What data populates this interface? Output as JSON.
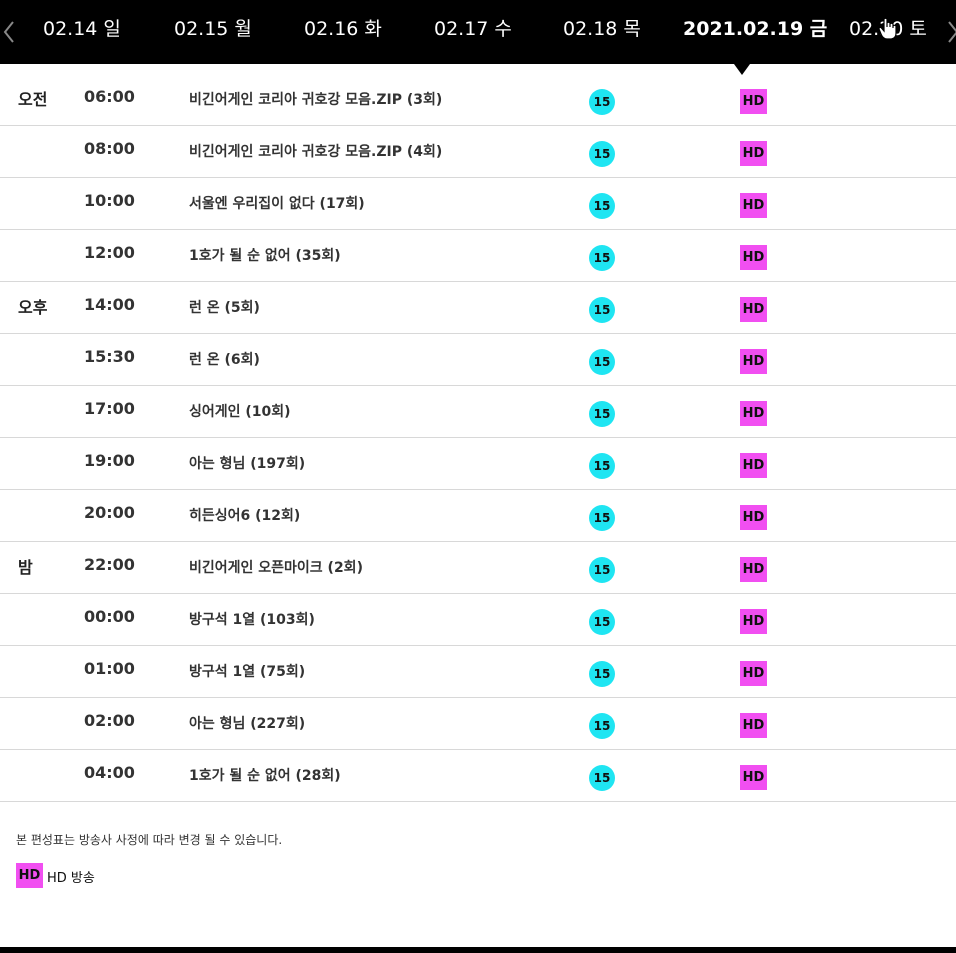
{
  "date_nav": {
    "tabs": [
      {
        "label": "02.14 일",
        "active": false
      },
      {
        "label": "02.15 월",
        "active": false
      },
      {
        "label": "02.16 화",
        "active": false
      },
      {
        "label": "02.17 수",
        "active": false
      },
      {
        "label": "02.18 목",
        "active": false
      },
      {
        "label": "2021.02.19 금",
        "active": true
      },
      {
        "label": "02.20 토",
        "active": false
      }
    ],
    "prev_icon": "chevron-left-icon",
    "next_icon": "chevron-right-icon"
  },
  "schedule": {
    "rows": [
      {
        "period": "오전",
        "time": "06:00",
        "title": "비긴어게인 코리아 귀호강 모음.ZIP (3회)",
        "rating": "15",
        "quality": "HD"
      },
      {
        "period": "",
        "time": "08:00",
        "title": "비긴어게인 코리아 귀호강 모음.ZIP (4회)",
        "rating": "15",
        "quality": "HD"
      },
      {
        "period": "",
        "time": "10:00",
        "title": "서울엔 우리집이 없다 (17회)",
        "rating": "15",
        "quality": "HD"
      },
      {
        "period": "",
        "time": "12:00",
        "title": "1호가 될 순 없어 (35회)",
        "rating": "15",
        "quality": "HD"
      },
      {
        "period": "오후",
        "time": "14:00",
        "title": "런 온 (5회)",
        "rating": "15",
        "quality": "HD"
      },
      {
        "period": "",
        "time": "15:30",
        "title": "런 온 (6회)",
        "rating": "15",
        "quality": "HD"
      },
      {
        "period": "",
        "time": "17:00",
        "title": "싱어게인 (10회)",
        "rating": "15",
        "quality": "HD"
      },
      {
        "period": "",
        "time": "19:00",
        "title": "아는 형님 (197회)",
        "rating": "15",
        "quality": "HD"
      },
      {
        "period": "",
        "time": "20:00",
        "title": "히든싱어6 (12회)",
        "rating": "15",
        "quality": "HD"
      },
      {
        "period": "밤",
        "time": "22:00",
        "title": "비긴어게인 오픈마이크 (2회)",
        "rating": "15",
        "quality": "HD"
      },
      {
        "period": "",
        "time": "00:00",
        "title": "방구석 1열 (103회)",
        "rating": "15",
        "quality": "HD"
      },
      {
        "period": "",
        "time": "01:00",
        "title": "방구석 1열 (75회)",
        "rating": "15",
        "quality": "HD"
      },
      {
        "period": "",
        "time": "02:00",
        "title": "아는 형님 (227회)",
        "rating": "15",
        "quality": "HD"
      },
      {
        "period": "",
        "time": "04:00",
        "title": "1호가 될 순 없어 (28회)",
        "rating": "15",
        "quality": "HD"
      }
    ]
  },
  "footer": {
    "notice": "본 편성표는 방송사 사정에 따라 변경 될 수 있습니다.",
    "legend_badge": "HD",
    "legend_label": "HD 방송"
  },
  "colors": {
    "nav_background": "#000000",
    "rating_badge": "#1fe5f2",
    "hd_badge": "#f14ff1",
    "row_divider": "#d8d8d8"
  }
}
